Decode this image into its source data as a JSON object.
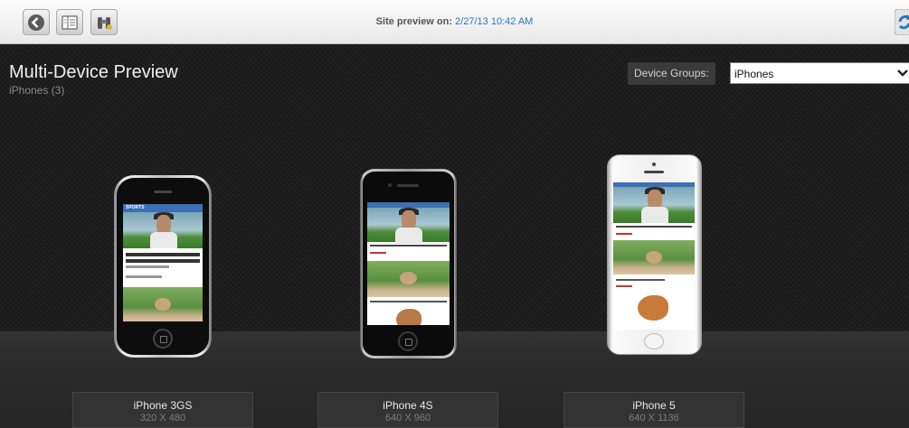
{
  "toolbar": {
    "preview_label": "Site preview on:",
    "preview_timestamp": "2/27/13 10:42 AM",
    "buttons": [
      {
        "name": "back",
        "icon": "back-arrow-icon"
      },
      {
        "name": "layout",
        "icon": "layout-panel-icon"
      },
      {
        "name": "binoculars",
        "icon": "binoculars-icon"
      },
      {
        "name": "refresh",
        "icon": "refresh-icon"
      }
    ]
  },
  "header": {
    "title": "Multi-Device Preview",
    "subtitle": "iPhones (3)"
  },
  "device_groups": {
    "label": "Device Groups:",
    "selected": "iPhones"
  },
  "devices": [
    {
      "name": "iPhone 3GS",
      "resolution": "320 X 480",
      "header_text": "SPORTS"
    },
    {
      "name": "iPhone 4S",
      "resolution": "640 X 960"
    },
    {
      "name": "iPhone 5",
      "resolution": "640 X 1136"
    }
  ],
  "colors": {
    "accent": "#2a78c0",
    "stage_bg": "#1e1e1e",
    "site_header": "#3c6fb3"
  }
}
